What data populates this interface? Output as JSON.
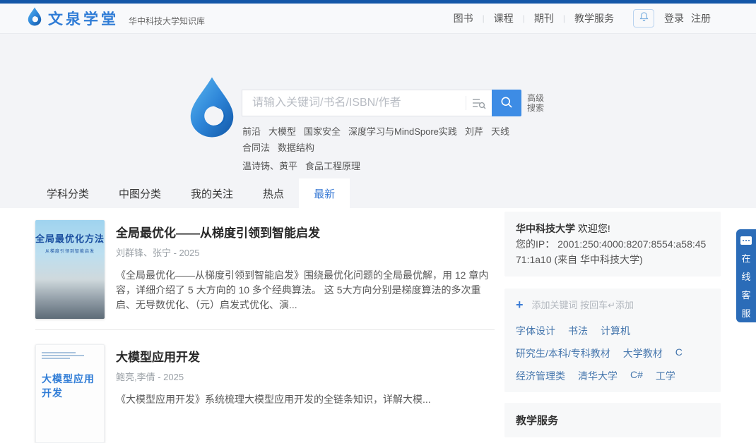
{
  "colors": {
    "top_strip": "#1457a8",
    "brand_blue": "#2f7cd6",
    "accent_blue": "#3d8ce5",
    "active_tab_blue": "#3a7bd5",
    "keyword_link_blue": "#4576ad",
    "service_tab_blue": "#2b6cb8"
  },
  "header": {
    "brand": "文泉学堂",
    "subtitle": "华中科技大学知识库",
    "nav": [
      {
        "label": "图书"
      },
      {
        "label": "课程"
      },
      {
        "label": "期刊"
      },
      {
        "label": "教学服务"
      }
    ],
    "login": "登录",
    "register": "注册"
  },
  "search": {
    "placeholder": "请输入关键词/书名/ISBN/作者",
    "advanced": [
      "高级",
      "搜索"
    ],
    "hot_line1": [
      "前沿",
      "大模型",
      "国家安全",
      "深度学习与MindSpore实践",
      "刘芹",
      "天线",
      "合同法",
      "数据结构"
    ],
    "hot_line2": [
      "温诗铸、黄平",
      "食品工程原理"
    ]
  },
  "tabs": [
    {
      "label": "学科分类",
      "active": false
    },
    {
      "label": "中图分类",
      "active": false
    },
    {
      "label": "我的关注",
      "active": false
    },
    {
      "label": "热点",
      "active": false
    },
    {
      "label": "最新",
      "active": true
    }
  ],
  "books": [
    {
      "cover_title": "全局最优化方法",
      "cover_subtitle": "从梯度引领到智能启发",
      "title": "全局最优化——从梯度引领到智能启发",
      "meta": "刘群锋、张宁 - 2025",
      "desc": "《全局最优化——从梯度引领到智能启发》围绕最优化问题的全局最优解，用 12 章内容，详细介绍了 5 大方向的 10 多个经典算法。 这 5大方向分别是梯度算法的多次重启、无导数优化、（元）启发式优化、演..."
    },
    {
      "cover_title": "大模型应用开发",
      "title": "大模型应用开发",
      "meta": "鲍亮,李倩 - 2025",
      "desc": "《大模型应用开发》系统梳理大模型应用开发的全链条知识，详解大模..."
    }
  ],
  "sidebar": {
    "university": "华中科技大学",
    "welcome": "欢迎您!",
    "ip_label": "您的IP：",
    "ip_value": "2001:250:4000:8207:8554:a58:4571:1a10 (来自 华中科技大学)",
    "add_plus": "+",
    "add_placeholder": "添加关键词 按回车↵添加",
    "keywords": [
      "字体设计",
      "书法",
      "计算机",
      "研究生/本科/专科教材",
      "大学教材",
      "C",
      "经济管理类",
      "清华大学",
      "C#",
      "工学"
    ],
    "section_title": "教学服务"
  },
  "service_tab": {
    "chars": [
      "在",
      "线",
      "客",
      "服"
    ]
  }
}
